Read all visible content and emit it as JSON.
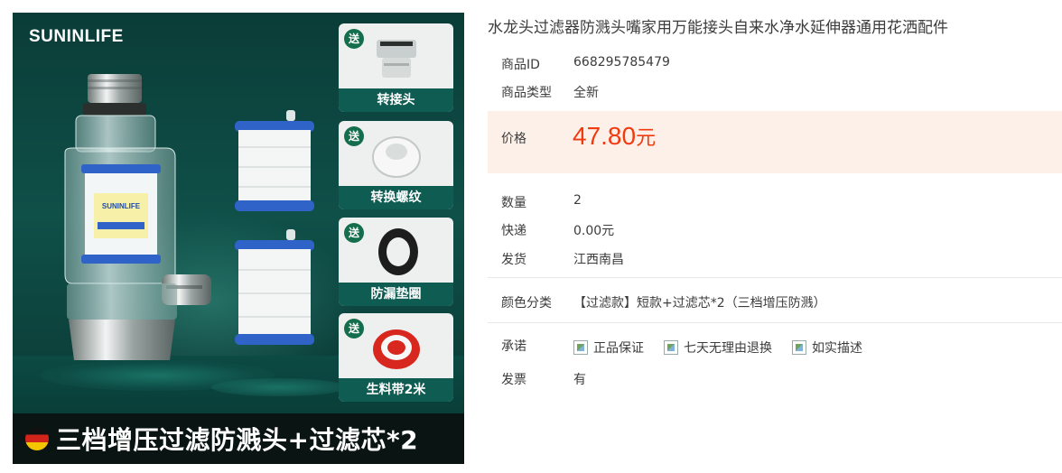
{
  "product": {
    "title": "水龙头过滤器防溅头嘴家用万能接头自来水净水延伸器通用花洒配件",
    "id_label": "商品ID",
    "id_value": "668295785479",
    "type_label": "商品类型",
    "type_value": "全新",
    "price_label": "价格",
    "price_value": "47.80",
    "price_unit": "元",
    "qty_label": "数量",
    "qty_value": "2",
    "shipping_label": "快递",
    "shipping_value": "0.00元",
    "ship_from_label": "发货",
    "ship_from_value": "江西南昌",
    "color_label": "颜色分类",
    "color_value": "【过滤款】短款+过滤芯*2（三档增压防溅）",
    "promise_label": "承诺",
    "promises": [
      "正品保证",
      "七天无理由退换",
      "如实描述"
    ],
    "invoice_label": "发票",
    "invoice_value": "有"
  },
  "image": {
    "brand": "SUNINLIFE",
    "banner": "三档增压过滤防溅头+过滤芯*2",
    "gift_tag": "送",
    "gifts": [
      "转接头",
      "转换螺纹",
      "防漏垫圈",
      "生料带2米"
    ],
    "filter_brand": "SUNINLIFE"
  },
  "colors": {
    "price": "#f23a0f",
    "price_bg": "#fdf0e9",
    "hero_bg": "#0f5049",
    "gift_label_bg": "#0f5c53"
  }
}
